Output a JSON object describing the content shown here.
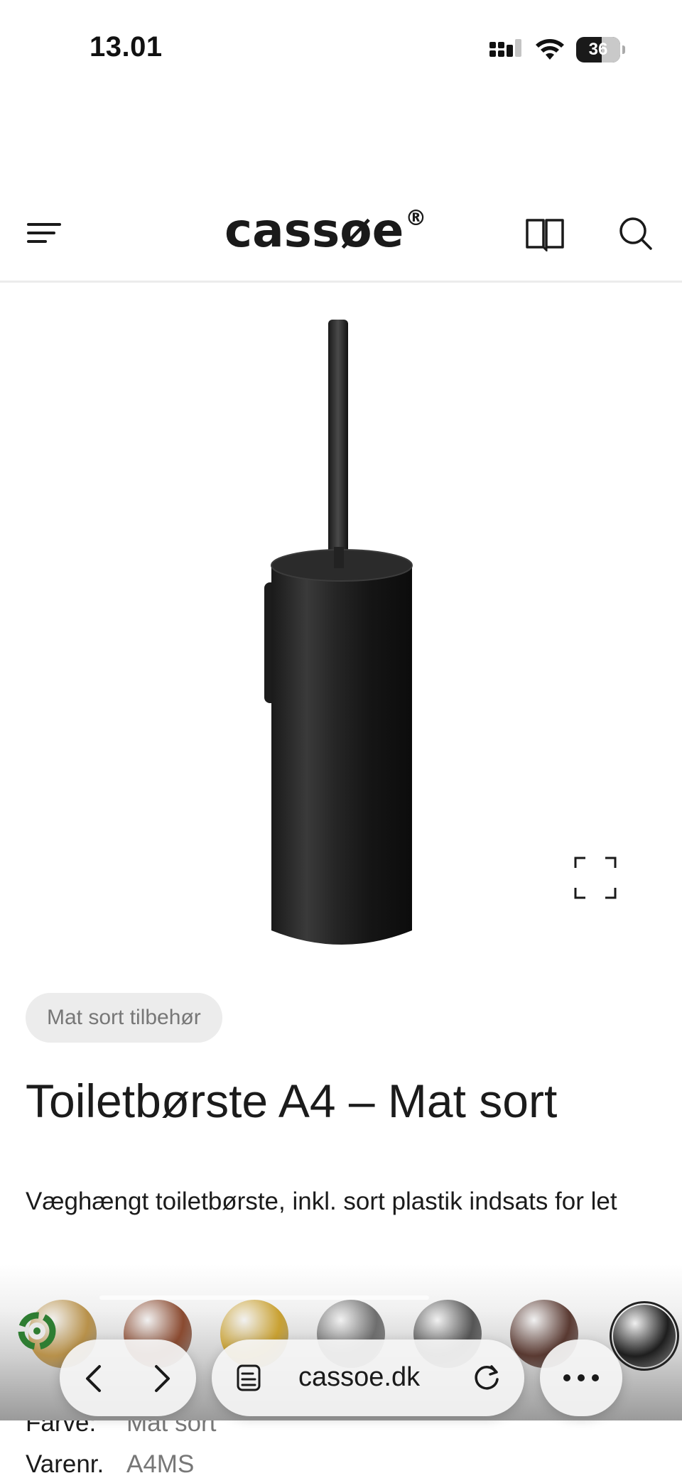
{
  "status_bar": {
    "time": "13.01",
    "battery": "36"
  },
  "header": {
    "logo": "cassøe",
    "logo_mark": "®"
  },
  "icons": {
    "menu": "menu-icon",
    "book": "book-icon",
    "search": "search-icon",
    "expand": "expand-icon",
    "eco": "recycle-icon",
    "back": "chevron-left-icon",
    "forward": "chevron-right-icon",
    "tabs": "tabs-icon",
    "reload": "reload-icon",
    "more": "more-icon"
  },
  "product": {
    "category": "Mat sort tilbehør",
    "title": "Toiletbørste A4 – Mat sort",
    "description": "Væghængt toiletbørste, inkl. sort plastik indsats for let"
  },
  "swatches": [
    {
      "name": "brushed-gold",
      "color": "#b8914a"
    },
    {
      "name": "copper",
      "color": "#8a4a30"
    },
    {
      "name": "gold",
      "color": "#c9a132"
    },
    {
      "name": "steel",
      "color": "#6e6e6e"
    },
    {
      "name": "gunmetal",
      "color": "#555555"
    },
    {
      "name": "dark-bronze",
      "color": "#5a3a32"
    },
    {
      "name": "matte-black",
      "color": "#1e1e1e",
      "selected": true
    }
  ],
  "browser": {
    "url": "cassoe.dk"
  },
  "details": {
    "color_label": "Farve:",
    "color_value": "Mat sort",
    "sku_label": "Varenr.",
    "sku_value": "A4MS"
  }
}
